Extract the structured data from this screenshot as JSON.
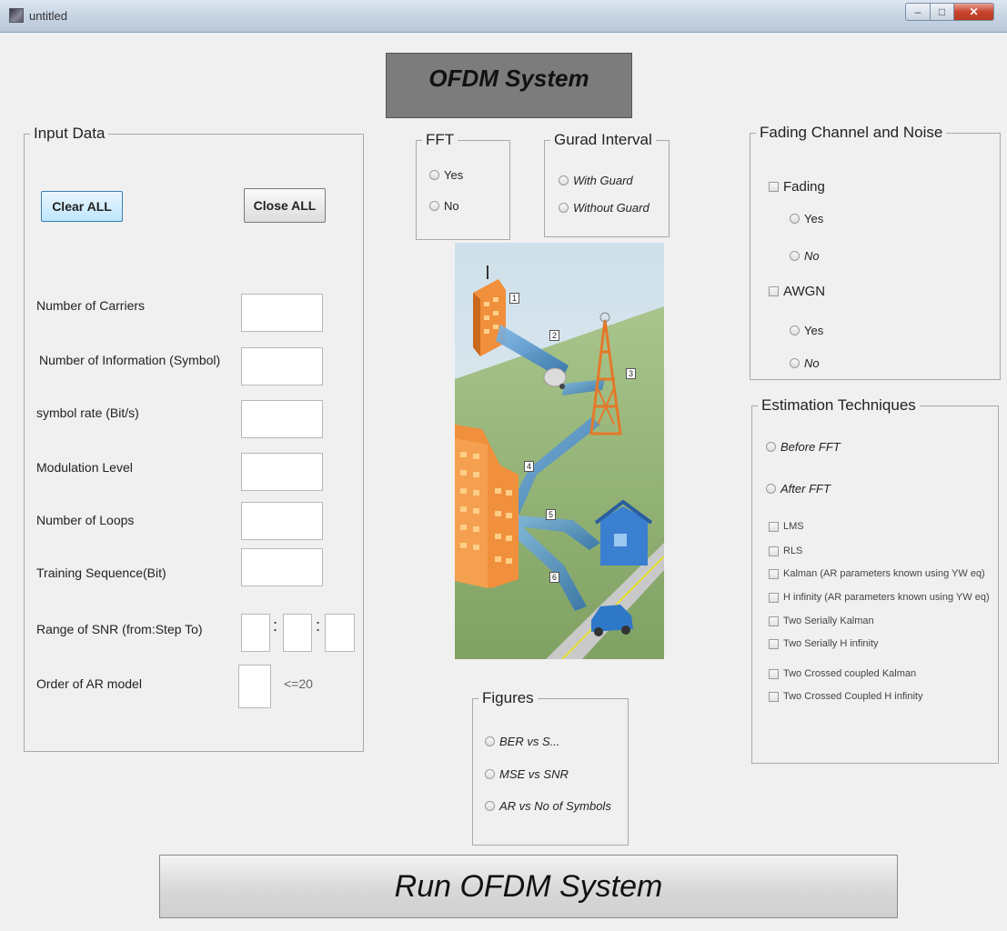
{
  "window": {
    "title": "untitled",
    "controls": {
      "minimize": "–",
      "maximize": "□",
      "close": "✕"
    }
  },
  "banner": {
    "title": "OFDM System"
  },
  "input_data": {
    "legend": "Input Data",
    "clear_all": "Clear ALL",
    "close_all": "Close ALL",
    "fields": [
      {
        "label": "Number of Carriers",
        "value": ""
      },
      {
        "label": "Number of Information (Symbol)",
        "value": ""
      },
      {
        "label": "symbol rate (Bit/s)",
        "value": ""
      },
      {
        "label": "Modulation Level",
        "value": ""
      },
      {
        "label": "Number of Loops",
        "value": ""
      },
      {
        "label": "Training Sequence(Bit)",
        "value": ""
      }
    ],
    "snr": {
      "label": "Range of SNR (from:Step To)",
      "sep1": ":",
      "sep2": ":",
      "from": "",
      "step": "",
      "to": ""
    },
    "ar": {
      "label": "Order of AR model",
      "hint": "<=20",
      "value": ""
    }
  },
  "fft": {
    "legend": "FFT",
    "options": [
      "Yes",
      "No"
    ]
  },
  "guard": {
    "legend": "Gurad Interval",
    "options": [
      "With Guard",
      "Without Guard"
    ]
  },
  "fading": {
    "legend": "Fading Channel and Noise",
    "fading_label": "Fading",
    "fading_options": [
      "Yes",
      "No"
    ],
    "awgn_label": "AWGN",
    "awgn_options": [
      "Yes",
      "No"
    ]
  },
  "estimation": {
    "legend": "Estimation Techniques",
    "radios": [
      "Before FFT",
      "After FFT"
    ],
    "checks": [
      "LMS",
      "RLS",
      "Kalman (AR parameters known using YW eq)",
      "H infinity (AR parameters known using YW eq)",
      "Two Serially Kalman",
      "Two Serially H infinity",
      "Two Crossed coupled Kalman",
      "Two Crossed Coupled H infinity"
    ]
  },
  "figures": {
    "legend": "Figures",
    "options": [
      "BER vs S...",
      "MSE vs SNR",
      "AR vs No of Symbols"
    ]
  },
  "illustration": {
    "labels": [
      "1",
      "2",
      "3",
      "4",
      "5",
      "6"
    ]
  },
  "run": {
    "label": "Run OFDM System"
  },
  "colors": {
    "banner": "#7c7c7c",
    "accent_blue": "#bee6fd",
    "building_orange": "#f0883a",
    "signal_blue": "#3a86c8"
  }
}
